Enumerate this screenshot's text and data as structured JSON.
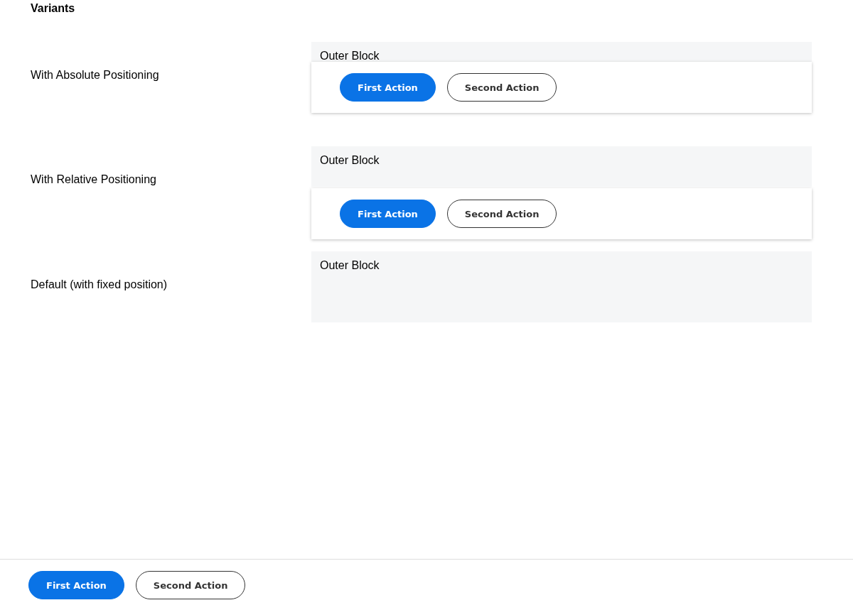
{
  "heading": "Variants",
  "variants": [
    {
      "label": "With Absolute Positioning",
      "kind": "absolute",
      "outer_text": "Outer Block",
      "actions": [
        {
          "label": "First Action",
          "kind": "primary"
        },
        {
          "label": "Second Action",
          "kind": "secondary"
        }
      ]
    },
    {
      "label": "With Relative Positioning",
      "kind": "relative",
      "outer_text": "Outer Block",
      "actions": [
        {
          "label": "First Action",
          "kind": "primary"
        },
        {
          "label": "Second Action",
          "kind": "secondary"
        }
      ]
    },
    {
      "label": "Default (with fixed position)",
      "kind": "fixed",
      "outer_text": "Outer Block",
      "actions": [
        {
          "label": "First Action",
          "kind": "primary"
        },
        {
          "label": "Second Action",
          "kind": "secondary"
        }
      ]
    }
  ]
}
